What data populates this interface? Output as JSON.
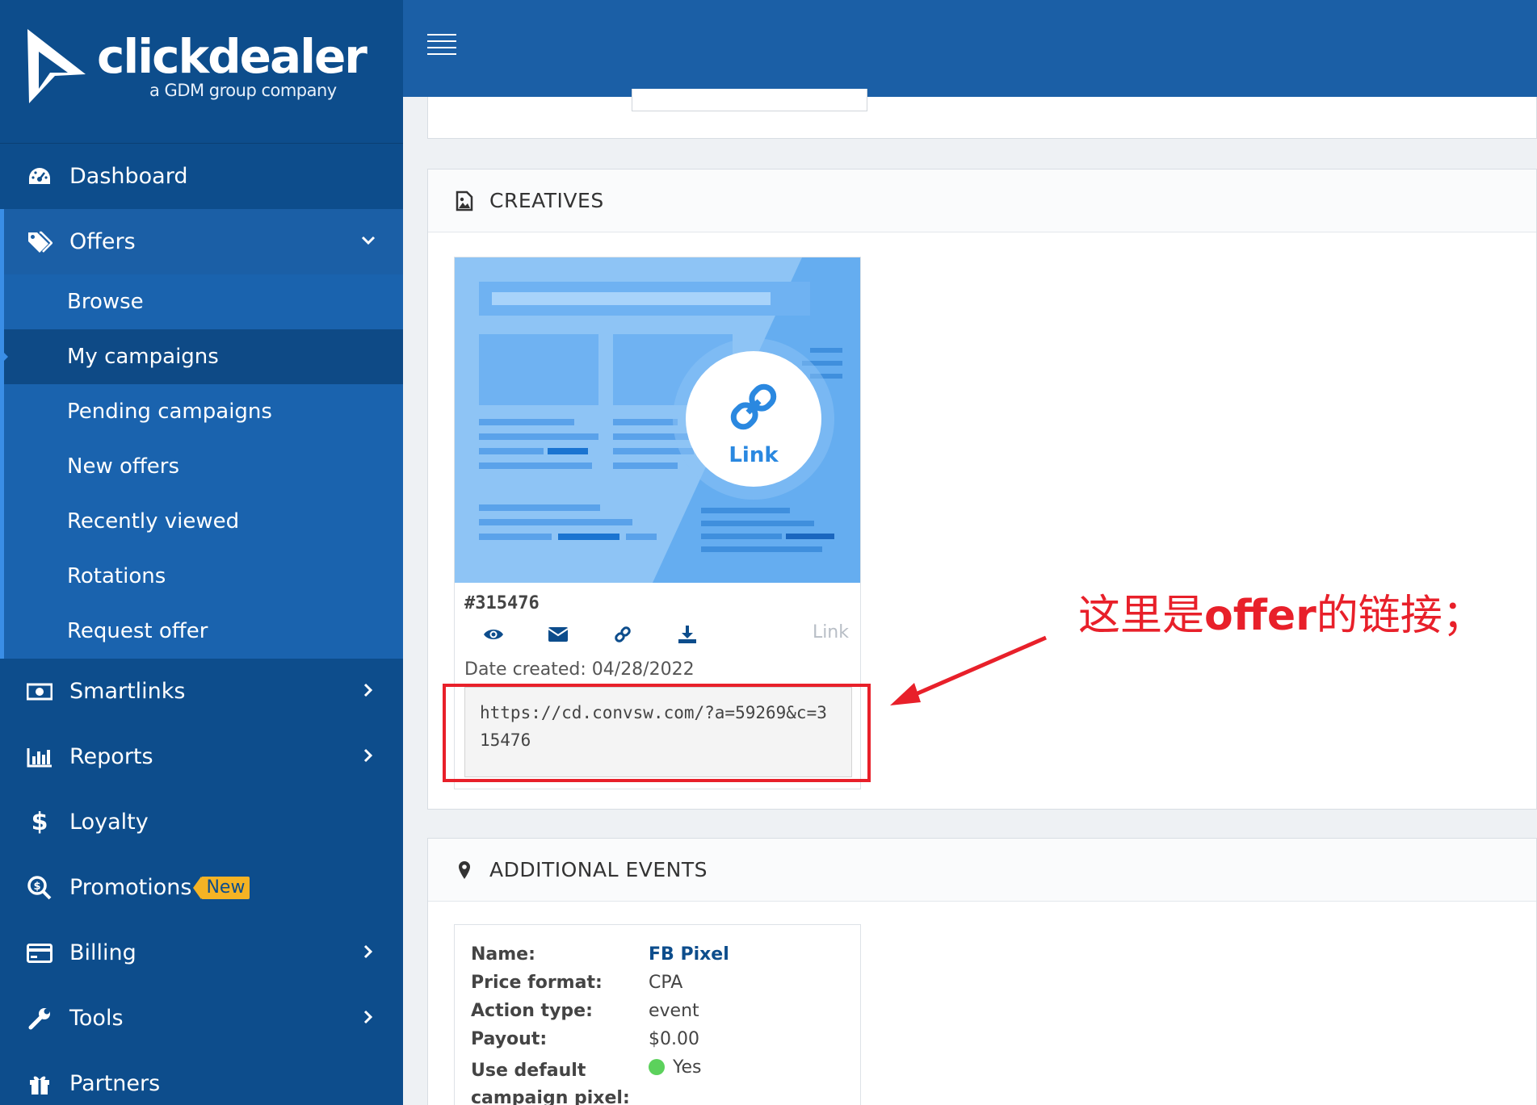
{
  "brand": {
    "name": "clickdealer",
    "tagline": "a GDM group company"
  },
  "sidebar": {
    "items": [
      {
        "label": "Dashboard",
        "icon": "dashboard-icon"
      },
      {
        "label": "Offers",
        "icon": "tags-icon",
        "expanded": true,
        "children": [
          "Browse",
          "My campaigns",
          "Pending campaigns",
          "New offers",
          "Recently viewed",
          "Rotations",
          "Request offer"
        ],
        "active_child": "My campaigns"
      },
      {
        "label": "Smartlinks",
        "icon": "money-icon"
      },
      {
        "label": "Reports",
        "icon": "bar-chart-icon"
      },
      {
        "label": "Loyalty",
        "icon": "dollar-icon"
      },
      {
        "label": "Promotions",
        "icon": "search-dollar-icon",
        "badge": "New"
      },
      {
        "label": "Billing",
        "icon": "credit-card-icon"
      },
      {
        "label": "Tools",
        "icon": "wrench-icon"
      },
      {
        "label": "Partners",
        "icon": "gift-icon"
      }
    ]
  },
  "creatives": {
    "title": "CREATIVES",
    "card": {
      "thumb_label": "Link",
      "id": "#315476",
      "type": "Link",
      "date": "Date created: 04/28/2022",
      "url": "https://cd.convsw.com/?a=59269&c=315476"
    }
  },
  "additional_events": {
    "title": "ADDITIONAL EVENTS",
    "rows": [
      {
        "key": "Name:",
        "value": "FB Pixel"
      },
      {
        "key": "Price format:",
        "value": "CPA"
      },
      {
        "key": "Action type:",
        "value": "event"
      },
      {
        "key": "Payout:",
        "value": "$0.00"
      },
      {
        "key": "Use default campaign pixel:",
        "value": "Yes"
      }
    ]
  },
  "annotation": {
    "prefix": "这里是",
    "bold": "offer",
    "suffix": "的链接；",
    "color": "#e8202a"
  },
  "colors": {
    "sidebar": "#0d4d8c",
    "topbar": "#1b5fa6",
    "accent": "#3a8ee6",
    "badge": "#f5b324"
  }
}
